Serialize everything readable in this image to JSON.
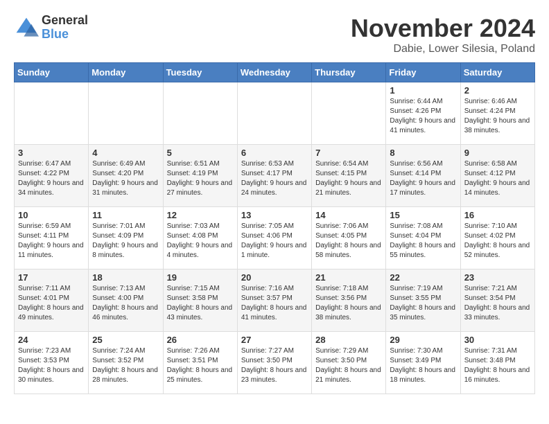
{
  "header": {
    "logo_general": "General",
    "logo_blue": "Blue",
    "month_title": "November 2024",
    "location": "Dabie, Lower Silesia, Poland"
  },
  "weekdays": [
    "Sunday",
    "Monday",
    "Tuesday",
    "Wednesday",
    "Thursday",
    "Friday",
    "Saturday"
  ],
  "weeks": [
    [
      {
        "day": "",
        "info": ""
      },
      {
        "day": "",
        "info": ""
      },
      {
        "day": "",
        "info": ""
      },
      {
        "day": "",
        "info": ""
      },
      {
        "day": "",
        "info": ""
      },
      {
        "day": "1",
        "info": "Sunrise: 6:44 AM\nSunset: 4:26 PM\nDaylight: 9 hours and 41 minutes."
      },
      {
        "day": "2",
        "info": "Sunrise: 6:46 AM\nSunset: 4:24 PM\nDaylight: 9 hours and 38 minutes."
      }
    ],
    [
      {
        "day": "3",
        "info": "Sunrise: 6:47 AM\nSunset: 4:22 PM\nDaylight: 9 hours and 34 minutes."
      },
      {
        "day": "4",
        "info": "Sunrise: 6:49 AM\nSunset: 4:20 PM\nDaylight: 9 hours and 31 minutes."
      },
      {
        "day": "5",
        "info": "Sunrise: 6:51 AM\nSunset: 4:19 PM\nDaylight: 9 hours and 27 minutes."
      },
      {
        "day": "6",
        "info": "Sunrise: 6:53 AM\nSunset: 4:17 PM\nDaylight: 9 hours and 24 minutes."
      },
      {
        "day": "7",
        "info": "Sunrise: 6:54 AM\nSunset: 4:15 PM\nDaylight: 9 hours and 21 minutes."
      },
      {
        "day": "8",
        "info": "Sunrise: 6:56 AM\nSunset: 4:14 PM\nDaylight: 9 hours and 17 minutes."
      },
      {
        "day": "9",
        "info": "Sunrise: 6:58 AM\nSunset: 4:12 PM\nDaylight: 9 hours and 14 minutes."
      }
    ],
    [
      {
        "day": "10",
        "info": "Sunrise: 6:59 AM\nSunset: 4:11 PM\nDaylight: 9 hours and 11 minutes."
      },
      {
        "day": "11",
        "info": "Sunrise: 7:01 AM\nSunset: 4:09 PM\nDaylight: 9 hours and 8 minutes."
      },
      {
        "day": "12",
        "info": "Sunrise: 7:03 AM\nSunset: 4:08 PM\nDaylight: 9 hours and 4 minutes."
      },
      {
        "day": "13",
        "info": "Sunrise: 7:05 AM\nSunset: 4:06 PM\nDaylight: 9 hours and 1 minute."
      },
      {
        "day": "14",
        "info": "Sunrise: 7:06 AM\nSunset: 4:05 PM\nDaylight: 8 hours and 58 minutes."
      },
      {
        "day": "15",
        "info": "Sunrise: 7:08 AM\nSunset: 4:04 PM\nDaylight: 8 hours and 55 minutes."
      },
      {
        "day": "16",
        "info": "Sunrise: 7:10 AM\nSunset: 4:02 PM\nDaylight: 8 hours and 52 minutes."
      }
    ],
    [
      {
        "day": "17",
        "info": "Sunrise: 7:11 AM\nSunset: 4:01 PM\nDaylight: 8 hours and 49 minutes."
      },
      {
        "day": "18",
        "info": "Sunrise: 7:13 AM\nSunset: 4:00 PM\nDaylight: 8 hours and 46 minutes."
      },
      {
        "day": "19",
        "info": "Sunrise: 7:15 AM\nSunset: 3:58 PM\nDaylight: 8 hours and 43 minutes."
      },
      {
        "day": "20",
        "info": "Sunrise: 7:16 AM\nSunset: 3:57 PM\nDaylight: 8 hours and 41 minutes."
      },
      {
        "day": "21",
        "info": "Sunrise: 7:18 AM\nSunset: 3:56 PM\nDaylight: 8 hours and 38 minutes."
      },
      {
        "day": "22",
        "info": "Sunrise: 7:19 AM\nSunset: 3:55 PM\nDaylight: 8 hours and 35 minutes."
      },
      {
        "day": "23",
        "info": "Sunrise: 7:21 AM\nSunset: 3:54 PM\nDaylight: 8 hours and 33 minutes."
      }
    ],
    [
      {
        "day": "24",
        "info": "Sunrise: 7:23 AM\nSunset: 3:53 PM\nDaylight: 8 hours and 30 minutes."
      },
      {
        "day": "25",
        "info": "Sunrise: 7:24 AM\nSunset: 3:52 PM\nDaylight: 8 hours and 28 minutes."
      },
      {
        "day": "26",
        "info": "Sunrise: 7:26 AM\nSunset: 3:51 PM\nDaylight: 8 hours and 25 minutes."
      },
      {
        "day": "27",
        "info": "Sunrise: 7:27 AM\nSunset: 3:50 PM\nDaylight: 8 hours and 23 minutes."
      },
      {
        "day": "28",
        "info": "Sunrise: 7:29 AM\nSunset: 3:50 PM\nDaylight: 8 hours and 21 minutes."
      },
      {
        "day": "29",
        "info": "Sunrise: 7:30 AM\nSunset: 3:49 PM\nDaylight: 8 hours and 18 minutes."
      },
      {
        "day": "30",
        "info": "Sunrise: 7:31 AM\nSunset: 3:48 PM\nDaylight: 8 hours and 16 minutes."
      }
    ]
  ]
}
